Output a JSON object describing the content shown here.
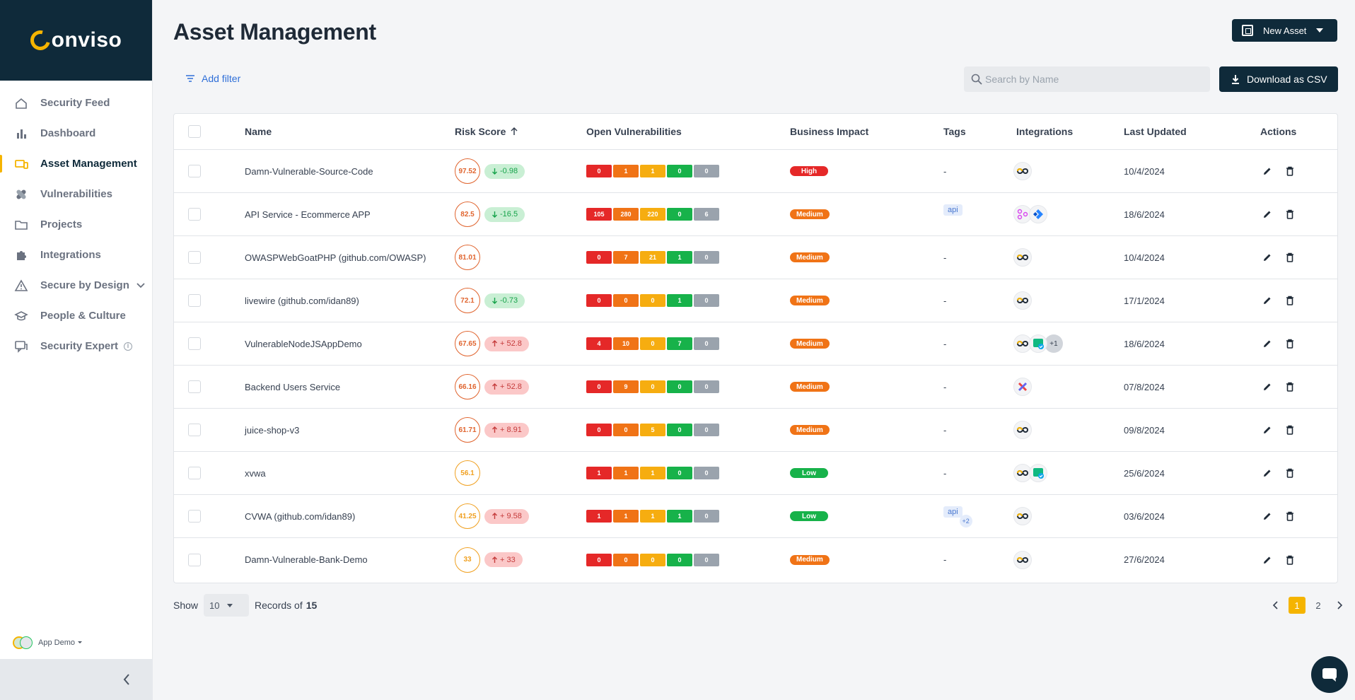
{
  "brand": {
    "name": "onviso"
  },
  "sidebar": {
    "items": [
      {
        "label": "Security Feed",
        "icon": "home-icon",
        "active": false
      },
      {
        "label": "Dashboard",
        "icon": "bar-chart-icon",
        "active": false
      },
      {
        "label": "Asset Management",
        "icon": "devices-icon",
        "active": true
      },
      {
        "label": "Vulnerabilities",
        "icon": "bandage-icon",
        "active": false
      },
      {
        "label": "Projects",
        "icon": "folder-icon",
        "active": false
      },
      {
        "label": "Integrations",
        "icon": "puzzle-icon",
        "active": false
      },
      {
        "label": "Secure by Design",
        "icon": "warning-icon",
        "active": false
      },
      {
        "label": "People & Culture",
        "icon": "graduation-cap-icon",
        "active": false
      },
      {
        "label": "Security Expert",
        "icon": "chat-icon",
        "active": false
      }
    ],
    "user": {
      "name": "App Demo"
    }
  },
  "header": {
    "title": "Asset Management",
    "new_asset_label": "New Asset"
  },
  "toolbar": {
    "add_filter_label": "Add filter",
    "search_placeholder": "Search by Name",
    "csv_label": "Download as CSV"
  },
  "table": {
    "columns": {
      "name": "Name",
      "risk": "Risk Score",
      "vulns": "Open Vulnerabilities",
      "impact": "Business Impact",
      "tags": "Tags",
      "integrations": "Integrations",
      "updated": "Last Updated",
      "actions": "Actions"
    },
    "rows": [
      {
        "name": "Damn-Vulnerable-Source-Code",
        "score": "97.52",
        "delta": "-0.98",
        "dir": "down",
        "v": [
          "0",
          "1",
          "1",
          "0",
          "0"
        ],
        "impact": "High",
        "tags": "-",
        "integrations": [
          "conviso"
        ],
        "updated": "10/4/2024"
      },
      {
        "name": "API Service - Ecommerce APP",
        "score": "82.5",
        "delta": "-16.5",
        "dir": "down",
        "v": [
          "105",
          "280",
          "220",
          "0",
          "6"
        ],
        "impact": "Medium",
        "tags": "api",
        "integrations": [
          "graph",
          "jira"
        ],
        "updated": "18/6/2024"
      },
      {
        "name": "OWASPWebGoatPHP (github.com/OWASP)",
        "score": "81.01",
        "delta": "",
        "dir": "",
        "v": [
          "0",
          "7",
          "21",
          "1",
          "0"
        ],
        "impact": "Medium",
        "tags": "-",
        "integrations": [
          "conviso"
        ],
        "updated": "10/4/2024"
      },
      {
        "name": "livewire (github.com/idan89)",
        "score": "72.1",
        "delta": "-0.73",
        "dir": "down",
        "v": [
          "0",
          "0",
          "0",
          "1",
          "0"
        ],
        "impact": "Medium",
        "tags": "-",
        "integrations": [
          "conviso"
        ],
        "updated": "17/1/2024"
      },
      {
        "name": "VulnerableNodeJSAppDemo",
        "score": "67.65",
        "delta": "+ 52.8",
        "dir": "up",
        "v": [
          "4",
          "10",
          "0",
          "7",
          "0"
        ],
        "impact": "Medium",
        "tags": "-",
        "integrations": [
          "conviso",
          "green"
        ],
        "more": "+1",
        "updated": "18/6/2024"
      },
      {
        "name": "Backend Users Service",
        "score": "66.16",
        "delta": "+ 52.8",
        "dir": "up",
        "v": [
          "0",
          "9",
          "0",
          "0",
          "0"
        ],
        "impact": "Medium",
        "tags": "-",
        "integrations": [
          "x"
        ],
        "updated": "07/8/2024"
      },
      {
        "name": "juice-shop-v3",
        "score": "61.71",
        "delta": "+ 8.91",
        "dir": "up",
        "v": [
          "0",
          "0",
          "5",
          "0",
          "0"
        ],
        "impact": "Medium",
        "tags": "-",
        "integrations": [
          "conviso"
        ],
        "updated": "09/8/2024"
      },
      {
        "name": "xvwa",
        "score": "56.1",
        "delta": "",
        "dir": "",
        "v": [
          "1",
          "1",
          "1",
          "0",
          "0"
        ],
        "impact": "Low",
        "tags": "-",
        "integrations": [
          "conviso",
          "green"
        ],
        "updated": "25/6/2024"
      },
      {
        "name": "CVWA (github.com/idan89)",
        "score": "41.25",
        "delta": "+ 9.58",
        "dir": "up",
        "v": [
          "1",
          "1",
          "1",
          "1",
          "0"
        ],
        "impact": "Low",
        "tags": "api",
        "tags_more": "+2",
        "integrations": [
          "conviso"
        ],
        "updated": "03/6/2024"
      },
      {
        "name": "Damn-Vulnerable-Bank-Demo",
        "score": "33",
        "delta": "+ 33",
        "dir": "up",
        "v": [
          "0",
          "0",
          "0",
          "0",
          "0"
        ],
        "impact": "Medium",
        "tags": "-",
        "integrations": [
          "conviso"
        ],
        "updated": "27/6/2024"
      }
    ]
  },
  "footer": {
    "show_label": "Show",
    "page_size": "10",
    "records_label": "Records of",
    "total": "15",
    "pages": [
      "1",
      "2"
    ],
    "current_page": "1"
  },
  "colors": {
    "brand_dark": "#0f2a3a",
    "accent": "#f5b400"
  }
}
